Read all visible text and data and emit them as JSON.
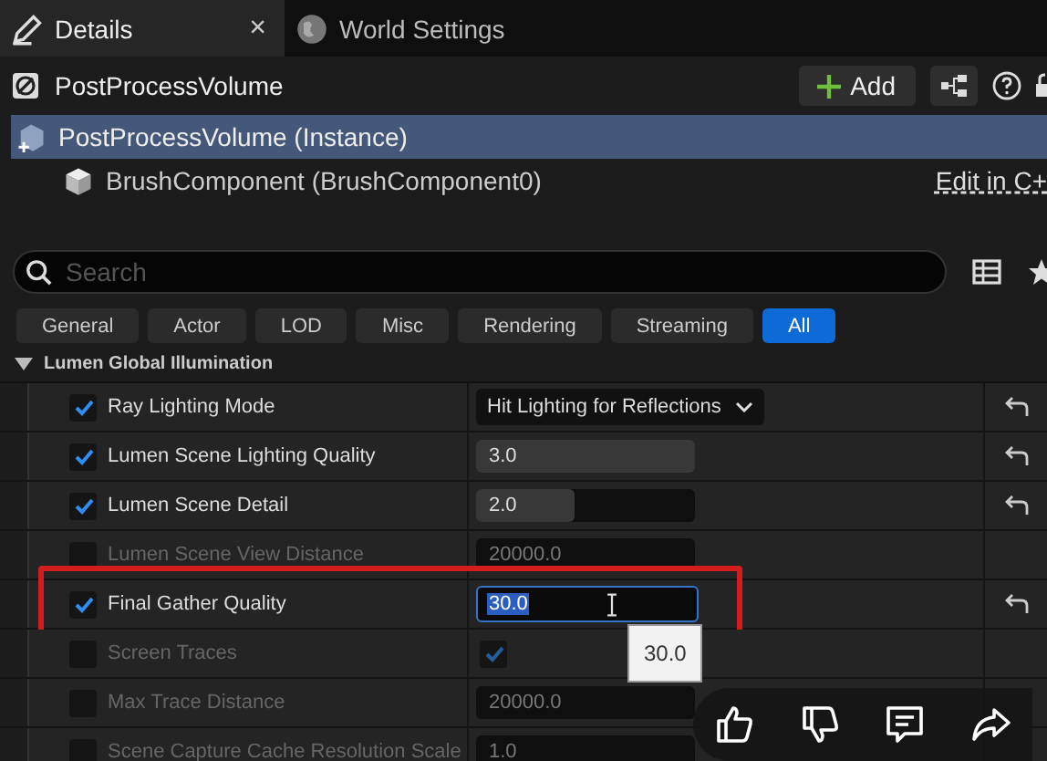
{
  "tabs": [
    {
      "label": "Details",
      "selected": true,
      "close": "×"
    },
    {
      "label": "World Settings",
      "selected": false
    }
  ],
  "header": {
    "title": "PostProcessVolume",
    "add_label": "Add"
  },
  "components": [
    {
      "label": "PostProcessVolume (Instance)",
      "selected": true
    },
    {
      "label": "BrushComponent (BrushComponent0)",
      "selected": false,
      "link": "Edit in C+"
    }
  ],
  "search": {
    "placeholder": "Search"
  },
  "filters": [
    {
      "label": "General",
      "selected": false
    },
    {
      "label": "Actor",
      "selected": false
    },
    {
      "label": "LOD",
      "selected": false
    },
    {
      "label": "Misc",
      "selected": false
    },
    {
      "label": "Rendering",
      "selected": false
    },
    {
      "label": "Streaming",
      "selected": false
    },
    {
      "label": "All",
      "selected": true
    }
  ],
  "section": {
    "title": "Lumen Global Illumination",
    "expanded": true
  },
  "properties": [
    {
      "label": "Ray Lighting Mode",
      "checked": true,
      "disabled": false,
      "kind": "dropdown",
      "value": "Hit Lighting for Reflections",
      "reset": true,
      "highlighted": false
    },
    {
      "label": "Lumen Scene Lighting Quality",
      "checked": true,
      "disabled": false,
      "kind": "slider",
      "value": "3.0",
      "level": 1,
      "reset": true,
      "highlighted": false
    },
    {
      "label": "Lumen Scene Detail",
      "checked": true,
      "disabled": false,
      "kind": "slider",
      "value": "2.0",
      "level": 0.45,
      "reset": true,
      "highlighted": false
    },
    {
      "label": "Lumen Scene View Distance",
      "checked": false,
      "disabled": true,
      "kind": "number",
      "value": "20000.0",
      "reset": false,
      "highlighted": false
    },
    {
      "label": "Final Gather Quality",
      "checked": true,
      "disabled": false,
      "kind": "editing",
      "value": "30.0",
      "tooltip": "30.0",
      "reset": true,
      "highlighted": true
    },
    {
      "label": "Screen Traces",
      "checked": false,
      "disabled": true,
      "kind": "bool",
      "value_checked": true,
      "reset": false,
      "highlighted": false
    },
    {
      "label": "Max Trace Distance",
      "checked": false,
      "disabled": true,
      "kind": "number",
      "value": "20000.0",
      "reset": false,
      "highlighted": false
    },
    {
      "label": "Scene Capture Cache Resolution Scale",
      "checked": false,
      "disabled": true,
      "kind": "number",
      "value": "1.0",
      "reset": false,
      "highlighted": false
    }
  ]
}
